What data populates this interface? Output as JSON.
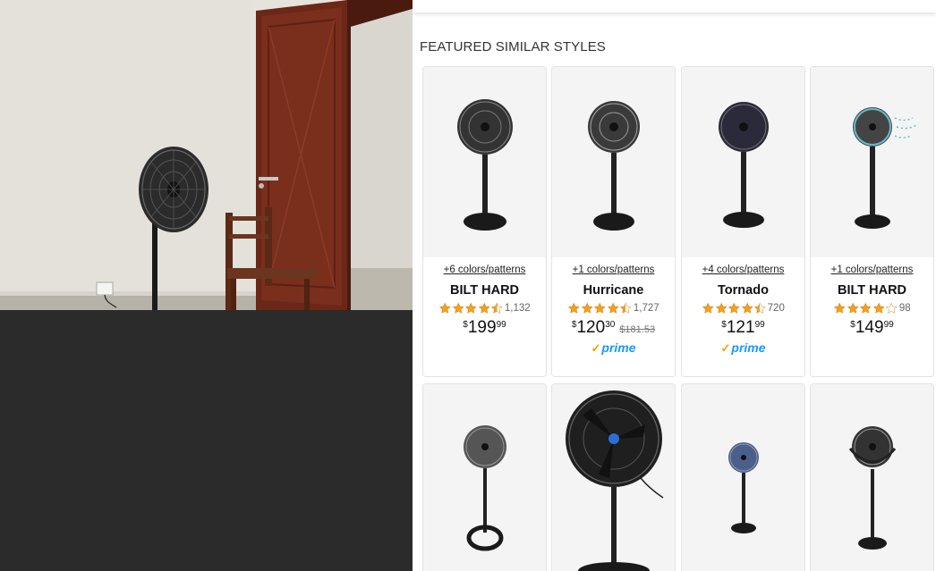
{
  "section_title": "FEATURED SIMILAR STYLES",
  "photo": {
    "description_icon": "room-photo-icon"
  },
  "products": [
    {
      "colors": "+6 colors/patterns",
      "brand": "BILT HARD",
      "rating": 4.5,
      "reviews": "1,132",
      "price_symbol": "$",
      "price_whole": "199",
      "price_fraction": "99",
      "old_price": "",
      "prime": ""
    },
    {
      "colors": "+1 colors/patterns",
      "brand": "Hurricane",
      "rating": 4.5,
      "reviews": "1,727",
      "price_symbol": "$",
      "price_whole": "120",
      "price_fraction": "30",
      "old_price": "$181.53",
      "prime": "prime"
    },
    {
      "colors": "+4 colors/patterns",
      "brand": "Tornado",
      "rating": 4.5,
      "reviews": "720",
      "price_symbol": "$",
      "price_whole": "121",
      "price_fraction": "99",
      "old_price": "",
      "prime": "prime"
    },
    {
      "colors": "+1 colors/patterns",
      "brand": "BILT HARD",
      "rating": 4.0,
      "reviews": "98",
      "price_symbol": "$",
      "price_whole": "149",
      "price_fraction": "99",
      "old_price": "",
      "prime": ""
    }
  ],
  "second_row_count": 4,
  "colors": {
    "star": "#f3a01d",
    "prime_blue": "#1a98ff",
    "prime_check": "#f0a200"
  }
}
